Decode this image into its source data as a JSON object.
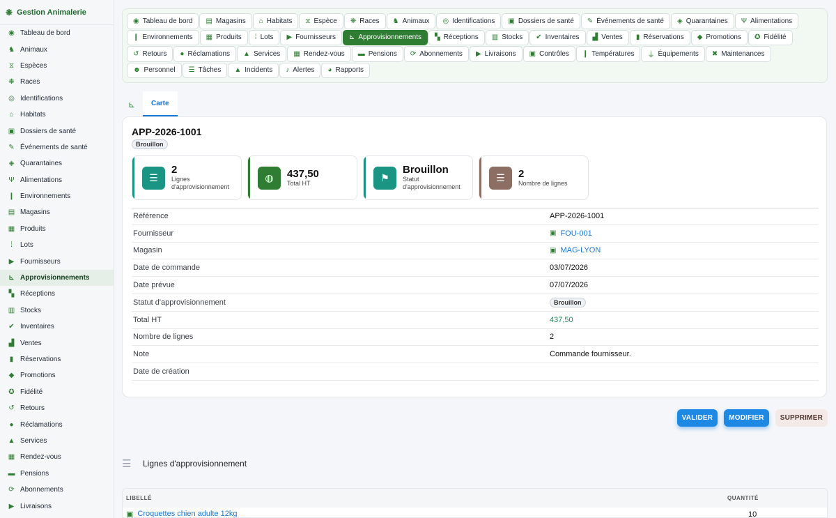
{
  "app": {
    "title": "Gestion Animalerie",
    "logo_icon": "paw-icon"
  },
  "sidebar": {
    "items": [
      {
        "label": "Tableau de bord",
        "icon": "gauge-icon",
        "glyph": "◉"
      },
      {
        "label": "Animaux",
        "icon": "animal-icon",
        "glyph": "♞"
      },
      {
        "label": "Espèces",
        "icon": "dna-icon",
        "glyph": "⧖"
      },
      {
        "label": "Races",
        "icon": "paw-icon",
        "glyph": "❋"
      },
      {
        "label": "Identifications",
        "icon": "fingerprint-icon",
        "glyph": "◎"
      },
      {
        "label": "Habitats",
        "icon": "house-icon",
        "glyph": "⌂"
      },
      {
        "label": "Dossiers de santé",
        "icon": "medical-file-icon",
        "glyph": "▣"
      },
      {
        "label": "Événements de santé",
        "icon": "syringe-icon",
        "glyph": "✎"
      },
      {
        "label": "Quarantaines",
        "icon": "shield-icon",
        "glyph": "◈"
      },
      {
        "label": "Alimentations",
        "icon": "utensils-icon",
        "glyph": "Ψ"
      },
      {
        "label": "Environnements",
        "icon": "thermometer-icon",
        "glyph": "❙"
      },
      {
        "label": "Magasins",
        "icon": "store-icon",
        "glyph": "▤"
      },
      {
        "label": "Produits",
        "icon": "box-icon",
        "glyph": "▦"
      },
      {
        "label": "Lots",
        "icon": "barcode-icon",
        "glyph": "⁞"
      },
      {
        "label": "Fournisseurs",
        "icon": "truck-icon",
        "glyph": "▶"
      },
      {
        "label": "Approvisionnements",
        "icon": "dolly-icon",
        "glyph": "⊾"
      },
      {
        "label": "Réceptions",
        "icon": "truck-loading-icon",
        "glyph": "▚"
      },
      {
        "label": "Stocks",
        "icon": "warehouse-icon",
        "glyph": "▥"
      },
      {
        "label": "Inventaires",
        "icon": "clipboard-check-icon",
        "glyph": "✔"
      },
      {
        "label": "Ventes",
        "icon": "cash-register-icon",
        "glyph": "▟"
      },
      {
        "label": "Réservations",
        "icon": "bookmark-icon",
        "glyph": "▮"
      },
      {
        "label": "Promotions",
        "icon": "tags-icon",
        "glyph": "◆"
      },
      {
        "label": "Fidélité",
        "icon": "award-icon",
        "glyph": "✪"
      },
      {
        "label": "Retours",
        "icon": "undo-icon",
        "glyph": "↺"
      },
      {
        "label": "Réclamations",
        "icon": "comment-icon",
        "glyph": "●"
      },
      {
        "label": "Services",
        "icon": "concierge-bell-icon",
        "glyph": "▲"
      },
      {
        "label": "Rendez-vous",
        "icon": "calendar-check-icon",
        "glyph": "▦"
      },
      {
        "label": "Pensions",
        "icon": "bed-icon",
        "glyph": "▬"
      },
      {
        "label": "Abonnements",
        "icon": "sync-icon",
        "glyph": "⟳"
      },
      {
        "label": "Livraisons",
        "icon": "delivery-truck-icon",
        "glyph": "▶"
      }
    ],
    "active_index": 15
  },
  "tabs": {
    "items": [
      {
        "label": "Tableau de bord",
        "icon": "gauge-icon",
        "glyph": "◉"
      },
      {
        "label": "Magasins",
        "icon": "store-icon",
        "glyph": "▤"
      },
      {
        "label": "Habitats",
        "icon": "house-icon",
        "glyph": "⌂"
      },
      {
        "label": "Espèce",
        "icon": "dna-icon",
        "glyph": "⧖"
      },
      {
        "label": "Races",
        "icon": "paw-icon",
        "glyph": "❋"
      },
      {
        "label": "Animaux",
        "icon": "animal-icon",
        "glyph": "♞"
      },
      {
        "label": "Identifications",
        "icon": "fingerprint-icon",
        "glyph": "◎"
      },
      {
        "label": "Dossiers de santé",
        "icon": "medical-file-icon",
        "glyph": "▣"
      },
      {
        "label": "Événements de santé",
        "icon": "syringe-icon",
        "glyph": "✎"
      },
      {
        "label": "Quarantaines",
        "icon": "shield-icon",
        "glyph": "◈"
      },
      {
        "label": "Alimentations",
        "icon": "utensils-icon",
        "glyph": "Ψ"
      },
      {
        "label": "Environnements",
        "icon": "thermometer-icon",
        "glyph": "❙"
      },
      {
        "label": "Produits",
        "icon": "box-icon",
        "glyph": "▦"
      },
      {
        "label": "Lots",
        "icon": "barcode-icon",
        "glyph": "⁞"
      },
      {
        "label": "Fournisseurs",
        "icon": "truck-icon",
        "glyph": "▶"
      },
      {
        "label": "Approvisionnements",
        "icon": "dolly-icon",
        "glyph": "⊾"
      },
      {
        "label": "Réceptions",
        "icon": "truck-loading-icon",
        "glyph": "▚"
      },
      {
        "label": "Stocks",
        "icon": "warehouse-icon",
        "glyph": "▥"
      },
      {
        "label": "Inventaires",
        "icon": "clipboard-check-icon",
        "glyph": "✔"
      },
      {
        "label": "Ventes",
        "icon": "cash-register-icon",
        "glyph": "▟"
      },
      {
        "label": "Réservations",
        "icon": "bookmark-icon",
        "glyph": "▮"
      },
      {
        "label": "Promotions",
        "icon": "tags-icon",
        "glyph": "◆"
      },
      {
        "label": "Fidélité",
        "icon": "award-icon",
        "glyph": "✪"
      },
      {
        "label": "Retours",
        "icon": "undo-icon",
        "glyph": "↺"
      },
      {
        "label": "Réclamations",
        "icon": "comment-icon",
        "glyph": "●"
      },
      {
        "label": "Services",
        "icon": "concierge-bell-icon",
        "glyph": "▲"
      },
      {
        "label": "Rendez-vous",
        "icon": "calendar-check-icon",
        "glyph": "▦"
      },
      {
        "label": "Pensions",
        "icon": "bed-icon",
        "glyph": "▬"
      },
      {
        "label": "Abonnements",
        "icon": "sync-icon",
        "glyph": "⟳"
      },
      {
        "label": "Livraisons",
        "icon": "delivery-truck-icon",
        "glyph": "▶"
      },
      {
        "label": "Contrôles",
        "icon": "clipboard-icon",
        "glyph": "▣"
      },
      {
        "label": "Températures",
        "icon": "thermometer-icon",
        "glyph": "❙"
      },
      {
        "label": "Équipements",
        "icon": "plug-icon",
        "glyph": "⏚"
      },
      {
        "label": "Maintenances",
        "icon": "tools-icon",
        "glyph": "✖"
      },
      {
        "label": "Personnel",
        "icon": "users-icon",
        "glyph": "☻"
      },
      {
        "label": "Tâches",
        "icon": "tasks-icon",
        "glyph": "☰"
      },
      {
        "label": "Incidents",
        "icon": "warning-icon",
        "glyph": "▲"
      },
      {
        "label": "Alertes",
        "icon": "bell-icon",
        "glyph": "♪"
      },
      {
        "label": "Rapports",
        "icon": "chart-pie-icon",
        "glyph": "◕"
      }
    ],
    "active_index": 15
  },
  "subtabs": {
    "icon": "dolly-icon",
    "active_label": "Carte"
  },
  "record": {
    "title": "APP-2026-1001",
    "status_badge": "Brouillon",
    "stats": [
      {
        "value": "2",
        "label": "Lignes d'approvisionnement",
        "icon": "list-icon",
        "glyph": "☰",
        "color": "#1a9483"
      },
      {
        "value": "437,50",
        "label": "Total HT",
        "icon": "coins-icon",
        "glyph": "◍",
        "color": "#2e7d32"
      },
      {
        "value": "Brouillon",
        "label": "Statut d'approvisionnement",
        "icon": "flag-icon",
        "glyph": "⚑",
        "color": "#1a9483"
      },
      {
        "value": "2",
        "label": "Nombre de lignes",
        "icon": "list-icon",
        "glyph": "☰",
        "color": "#8d6e63"
      }
    ],
    "fields": [
      {
        "key": "Référence",
        "value": "APP-2026-1001",
        "kind": "text"
      },
      {
        "key": "Fournisseur",
        "value": "FOU-001",
        "kind": "link"
      },
      {
        "key": "Magasin",
        "value": "MAG-LYON",
        "kind": "link"
      },
      {
        "key": "Date de commande",
        "value": "03/07/2026",
        "kind": "text"
      },
      {
        "key": "Date prévue",
        "value": "07/07/2026",
        "kind": "text"
      },
      {
        "key": "Statut d'approvisionnement",
        "value": "Brouillon",
        "kind": "badge"
      },
      {
        "key": "Total HT",
        "value": "437,50",
        "kind": "amount"
      },
      {
        "key": "Nombre de lignes",
        "value": "2",
        "kind": "text"
      },
      {
        "key": "Note",
        "value": "Commande fournisseur.",
        "kind": "text"
      },
      {
        "key": "Date de création",
        "value": "",
        "kind": "text"
      }
    ]
  },
  "actions": {
    "validate": "VALIDER",
    "edit": "MODIFIER",
    "delete": "SUPPRIMER"
  },
  "lines": {
    "title": "Lignes d'approvisionnement",
    "columns": [
      "LIBELLÉ",
      "QUANTITÉ"
    ],
    "rows": [
      {
        "label": "Croquettes chien adulte 12kg",
        "qty": "10"
      }
    ]
  }
}
